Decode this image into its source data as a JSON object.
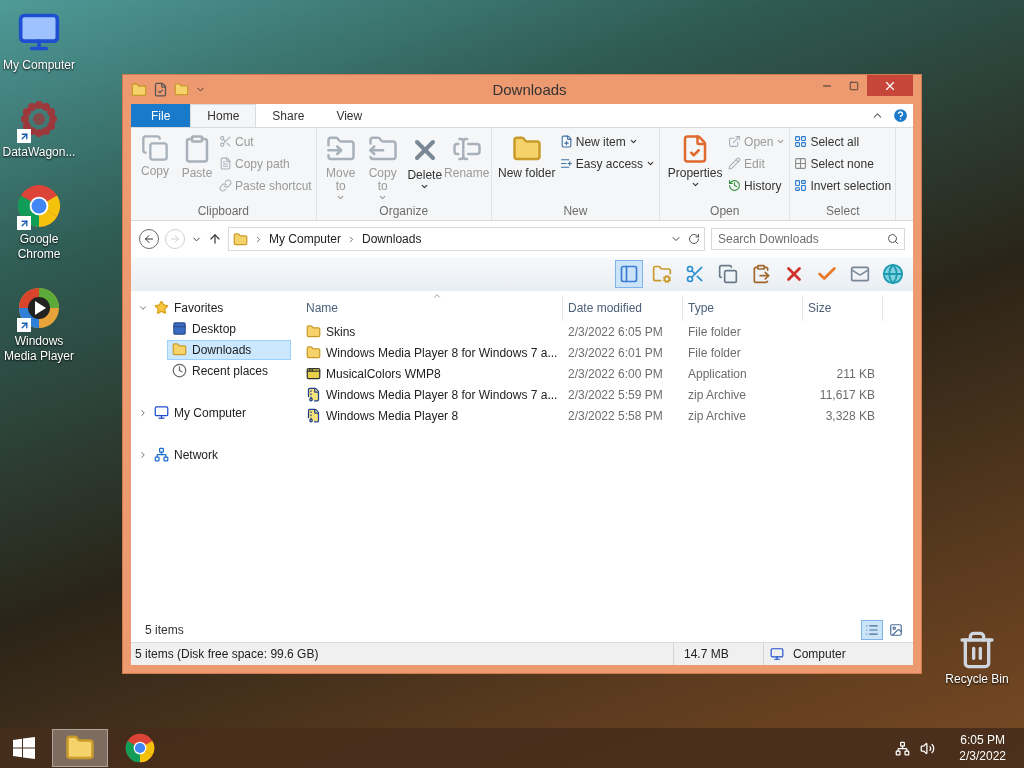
{
  "desktop_icons": [
    {
      "label": "My Computer",
      "kind": "computer"
    },
    {
      "label": "DataWagon...",
      "kind": "burst",
      "shortcut": true
    },
    {
      "label": "Google Chrome",
      "kind": "browser",
      "shortcut": true
    },
    {
      "label": "Windows Media Player",
      "kind": "player",
      "shortcut": true
    }
  ],
  "recycle_bin": {
    "label": "Recycle Bin"
  },
  "window": {
    "title": "Downloads",
    "ribbon_tabs": [
      {
        "label": "File",
        "kind": "file",
        "selected": false
      },
      {
        "label": "Home",
        "kind": "tab",
        "selected": true
      },
      {
        "label": "Share",
        "kind": "tab",
        "selected": false
      },
      {
        "label": "View",
        "kind": "tab",
        "selected": false
      }
    ],
    "ribbon_groups": [
      {
        "label": "Clipboard",
        "items": [
          {
            "label": "Copy",
            "kind": "large",
            "disabled": true,
            "dropdown": false
          },
          {
            "label": "Paste",
            "kind": "large",
            "disabled": true,
            "dropdown": false
          },
          {
            "label": "Cut",
            "kind": "small",
            "disabled": true,
            "dropdown": false
          },
          {
            "label": "Copy path",
            "kind": "small",
            "disabled": true,
            "dropdown": false
          },
          {
            "label": "Paste shortcut",
            "kind": "small",
            "disabled": true,
            "dropdown": false
          }
        ]
      },
      {
        "label": "Organize",
        "items": [
          {
            "label": "Move to",
            "kind": "large",
            "disabled": true,
            "dropdown": true
          },
          {
            "label": "Copy to",
            "kind": "large",
            "disabled": true,
            "dropdown": true
          },
          {
            "label": "Delete",
            "kind": "large",
            "disabled": false,
            "dropdown": true
          },
          {
            "label": "Rename",
            "kind": "large",
            "disabled": true,
            "dropdown": false
          }
        ]
      },
      {
        "label": "New",
        "items": [
          {
            "label": "New folder",
            "kind": "large",
            "disabled": false,
            "dropdown": false
          },
          {
            "label": "New item",
            "kind": "small",
            "disabled": false,
            "dropdown": true
          },
          {
            "label": "Easy access",
            "kind": "small",
            "disabled": false,
            "dropdown": true
          }
        ]
      },
      {
        "label": "Open",
        "items": [
          {
            "label": "Properties",
            "kind": "large",
            "disabled": false,
            "dropdown": true
          },
          {
            "label": "Open",
            "kind": "small",
            "disabled": true,
            "dropdown": true
          },
          {
            "label": "Edit",
            "kind": "small",
            "disabled": true,
            "dropdown": false
          },
          {
            "label": "History",
            "kind": "small",
            "disabled": false,
            "dropdown": false
          }
        ]
      },
      {
        "label": "Select",
        "items": [
          {
            "label": "Select all",
            "kind": "small",
            "disabled": false,
            "dropdown": false
          },
          {
            "label": "Select none",
            "kind": "small",
            "disabled": false,
            "dropdown": false
          },
          {
            "label": "Invert selection",
            "kind": "small",
            "disabled": false,
            "dropdown": false
          }
        ]
      }
    ],
    "navigation": {
      "back_disabled": false,
      "forward_disabled": true
    },
    "breadcrumbs": [
      "My Computer",
      "Downloads"
    ],
    "search": {
      "placeholder": "Search Downloads"
    },
    "toolbar_buttons": [
      {
        "selected": true
      },
      {
        "selected": false
      },
      {
        "selected": false
      },
      {
        "selected": false
      },
      {
        "selected": false
      },
      {
        "selected": false
      },
      {
        "selected": false
      },
      {
        "selected": false
      },
      {
        "selected": false
      }
    ],
    "tree": [
      {
        "label": "Favorites",
        "kind": "favorites",
        "expanded": true,
        "selected": false,
        "children": [
          {
            "label": "Desktop",
            "kind": "desktop",
            "selected": false
          },
          {
            "label": "Downloads",
            "kind": "downloads",
            "selected": true
          },
          {
            "label": "Recent places",
            "kind": "recent",
            "selected": false
          }
        ]
      },
      {
        "label": "My Computer",
        "kind": "computer",
        "expanded": false,
        "selected": false
      },
      {
        "label": "Network",
        "kind": "network",
        "expanded": false,
        "selected": false
      }
    ],
    "columns": [
      {
        "label": "Name",
        "sorted": true
      },
      {
        "label": "Date modified",
        "sorted": false
      },
      {
        "label": "Type",
        "sorted": false
      },
      {
        "label": "Size",
        "sorted": false
      }
    ],
    "rows": [
      {
        "name": "Skins",
        "date": "2/3/2022 6:05 PM",
        "type": "File folder",
        "kind": "folder",
        "selected": false
      },
      {
        "name": "Windows Media Player 8 for Windows 7 a...",
        "date": "2/3/2022 6:01 PM",
        "type": "File folder",
        "kind": "folder",
        "selected": false
      },
      {
        "name": "MusicalColors WMP8",
        "date": "2/3/2022 6:00 PM",
        "type": "Application",
        "size": "211 KB",
        "kind": "app",
        "selected": false
      },
      {
        "name": "Windows Media Player 8 for Windows 7 a...",
        "date": "2/3/2022 5:59 PM",
        "type": "zip Archive",
        "size": "11,617 KB",
        "kind": "zip",
        "selected": false
      },
      {
        "name": "Windows Media Player 8",
        "date": "2/3/2022 5:58 PM",
        "type": "zip Archive",
        "size": "3,328 KB",
        "kind": "zip",
        "selected": false
      }
    ],
    "item_count": "5 items",
    "view_buttons": [
      {
        "kind": "details",
        "selected": true
      },
      {
        "kind": "large_icons",
        "selected": false
      }
    ],
    "status_bar": {
      "summary": "5 items (Disk free space: 99.6 GB)",
      "size": "14.7 MB",
      "location": "Computer"
    }
  },
  "taskbar": {
    "apps": [
      {
        "kind": "explorer",
        "selected": true
      },
      {
        "kind": "browser",
        "selected": false
      }
    ],
    "time": "6:05 PM",
    "date": "2/3/2022"
  }
}
